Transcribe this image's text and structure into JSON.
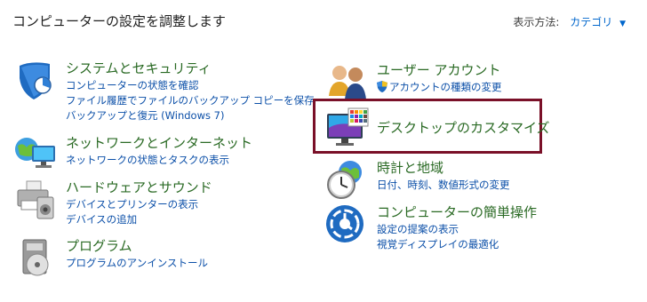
{
  "header": {
    "title": "コンピューターの設定を調整します",
    "view_by_label": "表示方法:",
    "view_by_value": "カテゴリ"
  },
  "categories": [
    {
      "title": "システムとセキュリティ",
      "links": [
        "コンピューターの状態を確認",
        "ファイル履歴でファイルのバックアップ コピーを保存",
        "バックアップと復元 (Windows 7)"
      ],
      "icon": "shield-icon"
    },
    {
      "title": "ネットワークとインターネット",
      "links": [
        "ネットワークの状態とタスクの表示"
      ],
      "icon": "network-icon"
    },
    {
      "title": "ハードウェアとサウンド",
      "links": [
        "デバイスとプリンターの表示",
        "デバイスの追加"
      ],
      "icon": "printer-icon"
    },
    {
      "title": "プログラム",
      "links": [
        "プログラムのアンインストール"
      ],
      "icon": "programs-icon"
    },
    {
      "title": "ユーザー アカウント",
      "links": [
        "アカウントの種類の変更"
      ],
      "icon": "users-icon"
    },
    {
      "title": "デスクトップのカスタマイズ",
      "links": [],
      "icon": "desktop-icon"
    },
    {
      "title": "時計と地域",
      "links": [
        "日付、時刻、数値形式の変更"
      ],
      "icon": "clock-icon"
    },
    {
      "title": "コンピューターの簡単操作",
      "links": [
        "設定の提案の表示",
        "視覚ディスプレイの最適化"
      ],
      "icon": "ease-of-access-icon"
    }
  ],
  "colors": {
    "category_title": "#2a6a24",
    "link": "#0b4fa8",
    "highlight_border": "#7a1028"
  }
}
